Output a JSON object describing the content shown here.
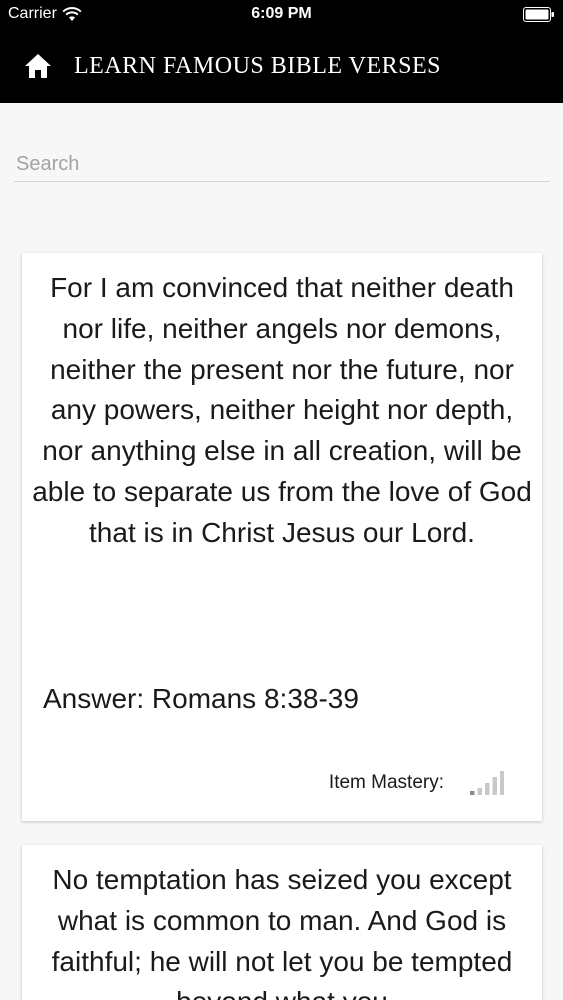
{
  "status_bar": {
    "carrier": "Carrier",
    "time": "6:09 PM"
  },
  "navbar": {
    "title": "LEARN FAMOUS BIBLE VERSES"
  },
  "search": {
    "placeholder": "Search",
    "value": ""
  },
  "cards": [
    {
      "verse": "For I am convinced that neither death nor life, neither angels nor demons, neither the present nor the future, nor any powers, neither height nor depth, nor anything else in all creation, will be able to separate us from the love of God that is in Christ Jesus our Lord.",
      "answer": "Answer: Romans 8:38-39",
      "mastery_label": "Item Mastery:",
      "mastery_level": 0.25
    },
    {
      "verse": "No temptation has seized you except what is common to man. And God is faithful; he will not let you be tempted beyond what you"
    }
  ],
  "colors": {
    "header_bg": "#000000",
    "page_bg": "#f7f7f8",
    "mastery_active": "#8c8c8c",
    "mastery_inactive": "#c8c8c8"
  },
  "icons": {
    "home": "home-icon",
    "wifi": "wifi-icon",
    "battery": "battery-icon",
    "mastery": "signal-bars-icon"
  }
}
